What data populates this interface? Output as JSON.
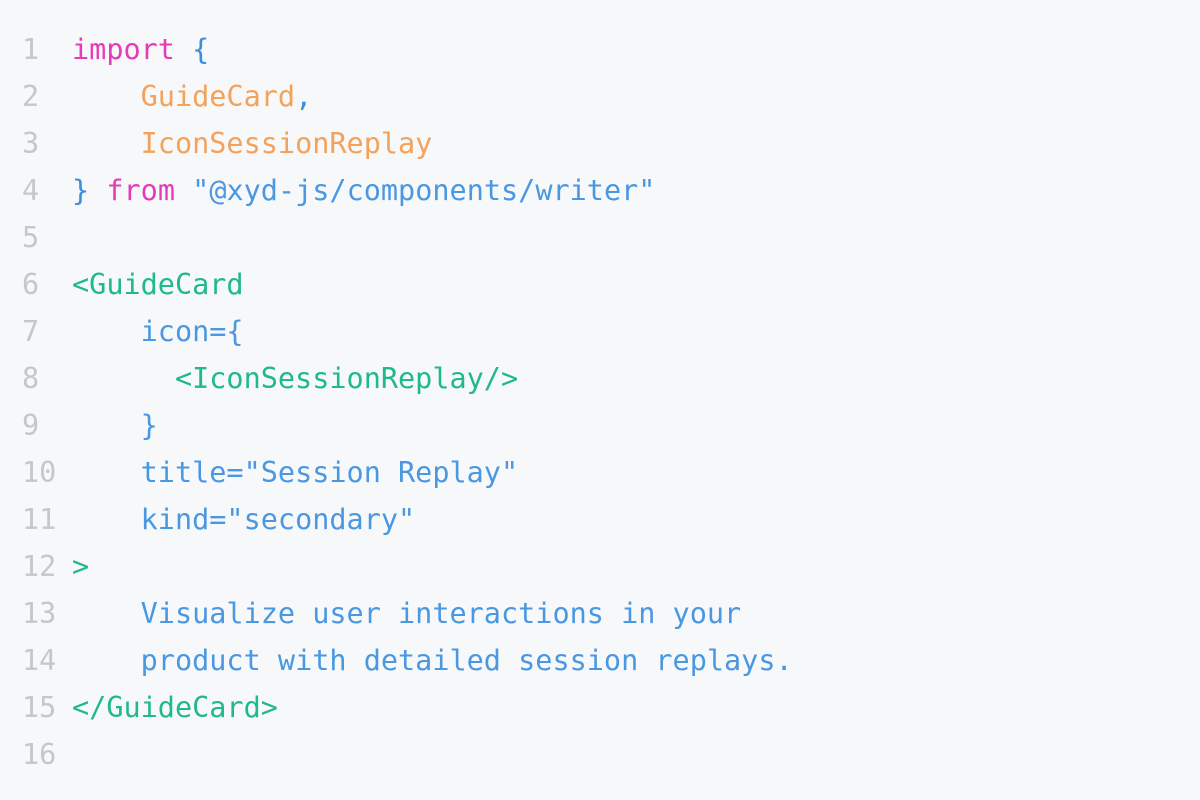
{
  "colors": {
    "keyword": "#e73ab8",
    "punct": "#3b8fe0",
    "identifier": "#f3a25c",
    "tag": "#1fb98a",
    "attr": "#4a97e2",
    "text": "#4a97e2",
    "line_number": "#c4c7cc",
    "background": "#f7f8fa"
  },
  "lines": [
    {
      "n": "1",
      "tokens": [
        {
          "t": "import",
          "c": "keyword"
        },
        {
          "t": " ",
          "c": "text"
        },
        {
          "t": "{",
          "c": "punct"
        }
      ]
    },
    {
      "n": "2",
      "tokens": [
        {
          "t": "    ",
          "c": "text"
        },
        {
          "t": "GuideCard",
          "c": "identifier"
        },
        {
          "t": ",",
          "c": "punct"
        }
      ]
    },
    {
      "n": "3",
      "tokens": [
        {
          "t": "    ",
          "c": "text"
        },
        {
          "t": "IconSessionReplay",
          "c": "identifier"
        }
      ]
    },
    {
      "n": "4",
      "tokens": [
        {
          "t": "}",
          "c": "punct"
        },
        {
          "t": " ",
          "c": "text"
        },
        {
          "t": "from",
          "c": "keyword"
        },
        {
          "t": " ",
          "c": "text"
        },
        {
          "t": "\"@xyd-js/components/writer\"",
          "c": "attr"
        }
      ]
    },
    {
      "n": "5",
      "tokens": []
    },
    {
      "n": "6",
      "tokens": [
        {
          "t": "<GuideCard",
          "c": "tag"
        }
      ]
    },
    {
      "n": "7",
      "tokens": [
        {
          "t": "    ",
          "c": "text"
        },
        {
          "t": "icon={",
          "c": "attr"
        }
      ]
    },
    {
      "n": "8",
      "tokens": [
        {
          "t": "      ",
          "c": "text"
        },
        {
          "t": "<IconSessionReplay/>",
          "c": "tag"
        }
      ]
    },
    {
      "n": "9",
      "tokens": [
        {
          "t": "    ",
          "c": "text"
        },
        {
          "t": "}",
          "c": "attr"
        }
      ]
    },
    {
      "n": "10",
      "tokens": [
        {
          "t": "    ",
          "c": "text"
        },
        {
          "t": "title=\"Session Replay\"",
          "c": "attr"
        }
      ]
    },
    {
      "n": "11",
      "tokens": [
        {
          "t": "    ",
          "c": "text"
        },
        {
          "t": "kind=\"secondary\"",
          "c": "attr"
        }
      ]
    },
    {
      "n": "12",
      "tokens": [
        {
          "t": ">",
          "c": "tag"
        }
      ]
    },
    {
      "n": "13",
      "tokens": [
        {
          "t": "    ",
          "c": "text"
        },
        {
          "t": "Visualize user interactions in your",
          "c": "text"
        }
      ]
    },
    {
      "n": "14",
      "tokens": [
        {
          "t": "    ",
          "c": "text"
        },
        {
          "t": "product with detailed session replays.",
          "c": "text"
        }
      ]
    },
    {
      "n": "15",
      "tokens": [
        {
          "t": "</GuideCard>",
          "c": "tag"
        }
      ]
    },
    {
      "n": "16",
      "tokens": []
    }
  ]
}
